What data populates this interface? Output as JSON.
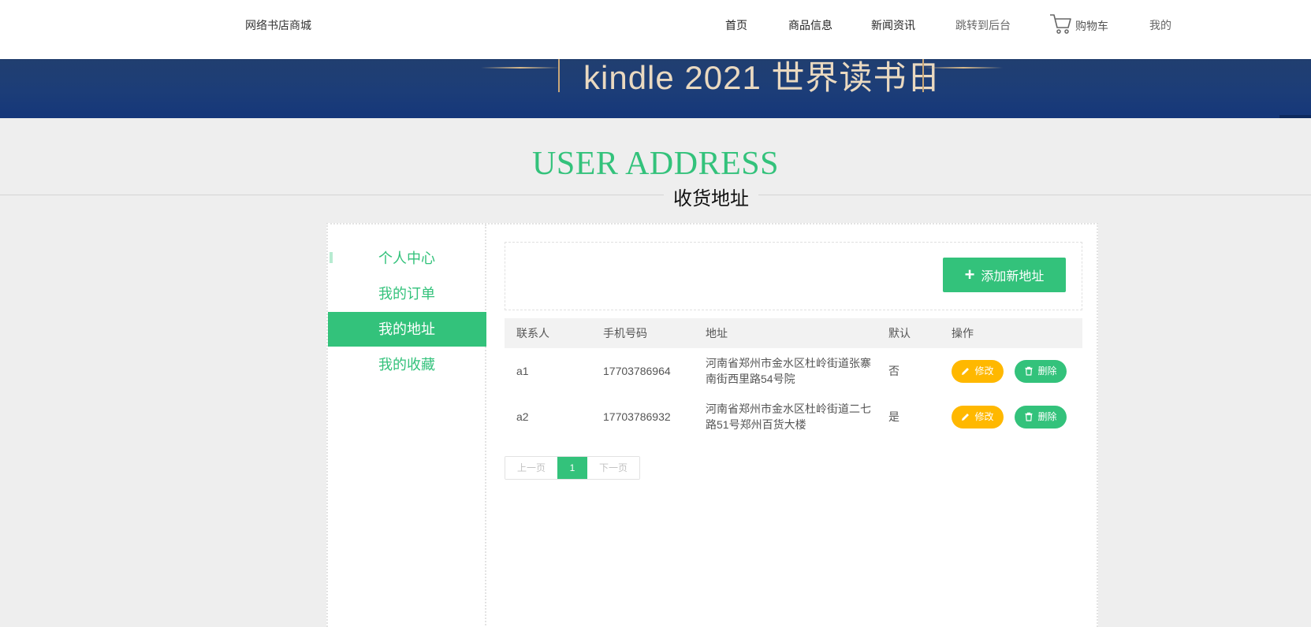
{
  "header": {
    "brand": "网络书店商城",
    "nav": [
      {
        "label": "首页"
      },
      {
        "label": "商品信息"
      },
      {
        "label": "新闻资讯"
      },
      {
        "label": "跳转到后台"
      }
    ],
    "cart_label": "购物车",
    "mine_label": "我的",
    "cart_icon": "cart-icon"
  },
  "banner": {
    "text": "kindle 2021 世界读书日"
  },
  "section": {
    "title_en": "USER ADDRESS",
    "title_cn": "收货地址"
  },
  "sidebar": {
    "items": [
      {
        "label": "个人中心",
        "active": false
      },
      {
        "label": "我的订单",
        "active": false
      },
      {
        "label": "我的地址",
        "active": true
      },
      {
        "label": "我的收藏",
        "active": false
      }
    ]
  },
  "main": {
    "add_button": "添加新地址",
    "table": {
      "headers": [
        "联系人",
        "手机号码",
        "地址",
        "默认",
        "操作"
      ],
      "rows": [
        {
          "name": "a1",
          "phone": "17703786964",
          "address": "河南省郑州市金水区杜岭街道张寨南街西里路54号院",
          "default": "否",
          "edit": "修改",
          "delete": "删除"
        },
        {
          "name": "a2",
          "phone": "17703786932",
          "address": "河南省郑州市金水区杜岭街道二七路51号郑州百货大楼",
          "default": "是",
          "edit": "修改",
          "delete": "删除"
        }
      ]
    },
    "pagination": {
      "prev": "上一页",
      "current": "1",
      "next": "下一页"
    }
  },
  "colors": {
    "accent": "#33c27b",
    "edit": "#ffb800",
    "banner": "#1c3d78"
  }
}
